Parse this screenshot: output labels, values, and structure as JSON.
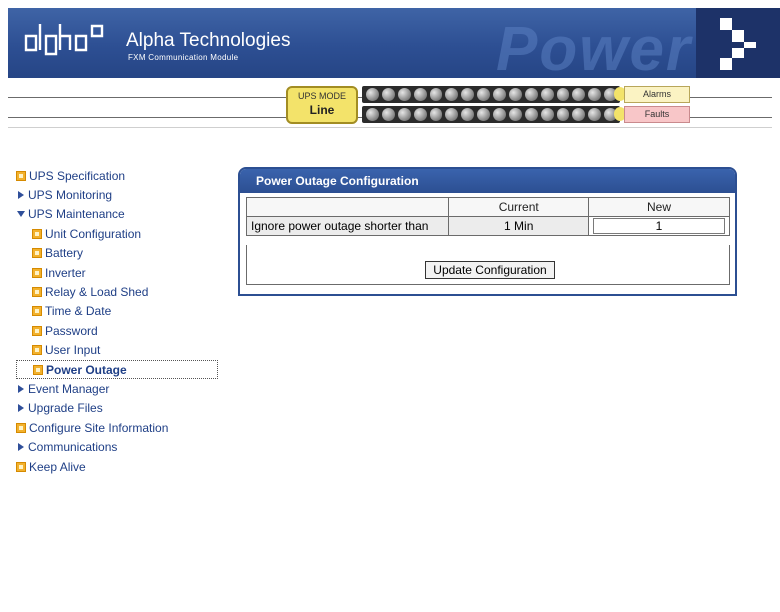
{
  "header": {
    "brand_title": "Alpha Technologies",
    "brand_subtitle": "FXM Communication Module",
    "watermark": "Power",
    "logo_icon": "alpha-logo-icon",
    "chevron_icon": "chevron-right-icon"
  },
  "status": {
    "ups_mode_label": "UPS MODE",
    "ups_mode_value": "Line",
    "alarms_label": "Alarms",
    "faults_label": "Faults",
    "leds_per_row": 16
  },
  "sidebar": {
    "items": [
      {
        "label": "UPS Specification",
        "icon": "doc-icon"
      },
      {
        "label": "UPS Monitoring",
        "icon": "expand-arrow-icon"
      },
      {
        "label": "UPS Maintenance",
        "icon": "collapse-arrow-icon"
      },
      {
        "label": "Unit Configuration",
        "icon": "doc-icon"
      },
      {
        "label": "Battery",
        "icon": "doc-icon"
      },
      {
        "label": "Inverter",
        "icon": "doc-icon"
      },
      {
        "label": "Relay & Load Shed",
        "icon": "doc-icon"
      },
      {
        "label": "Time & Date",
        "icon": "doc-icon"
      },
      {
        "label": "Password",
        "icon": "doc-icon"
      },
      {
        "label": "User Input",
        "icon": "doc-icon"
      },
      {
        "label": "Power Outage",
        "icon": "doc-icon"
      },
      {
        "label": "Event Manager",
        "icon": "expand-arrow-icon"
      },
      {
        "label": "Upgrade Files",
        "icon": "expand-arrow-icon"
      },
      {
        "label": "Configure Site Information",
        "icon": "doc-icon"
      },
      {
        "label": "Communications",
        "icon": "expand-arrow-icon"
      },
      {
        "label": "Keep Alive",
        "icon": "doc-icon"
      }
    ]
  },
  "panel": {
    "title": "Power Outage Configuration",
    "col_current": "Current",
    "col_new": "New",
    "row_label": "Ignore power outage shorter than",
    "row_current": "1 Min",
    "row_new_value": "1",
    "update_button": "Update Configuration"
  },
  "colors": {
    "header_blue": "#2d4f93",
    "link_blue": "#1f3f86",
    "mode_yellow": "#f3e36a",
    "faults_pink": "#f8c6c8"
  }
}
